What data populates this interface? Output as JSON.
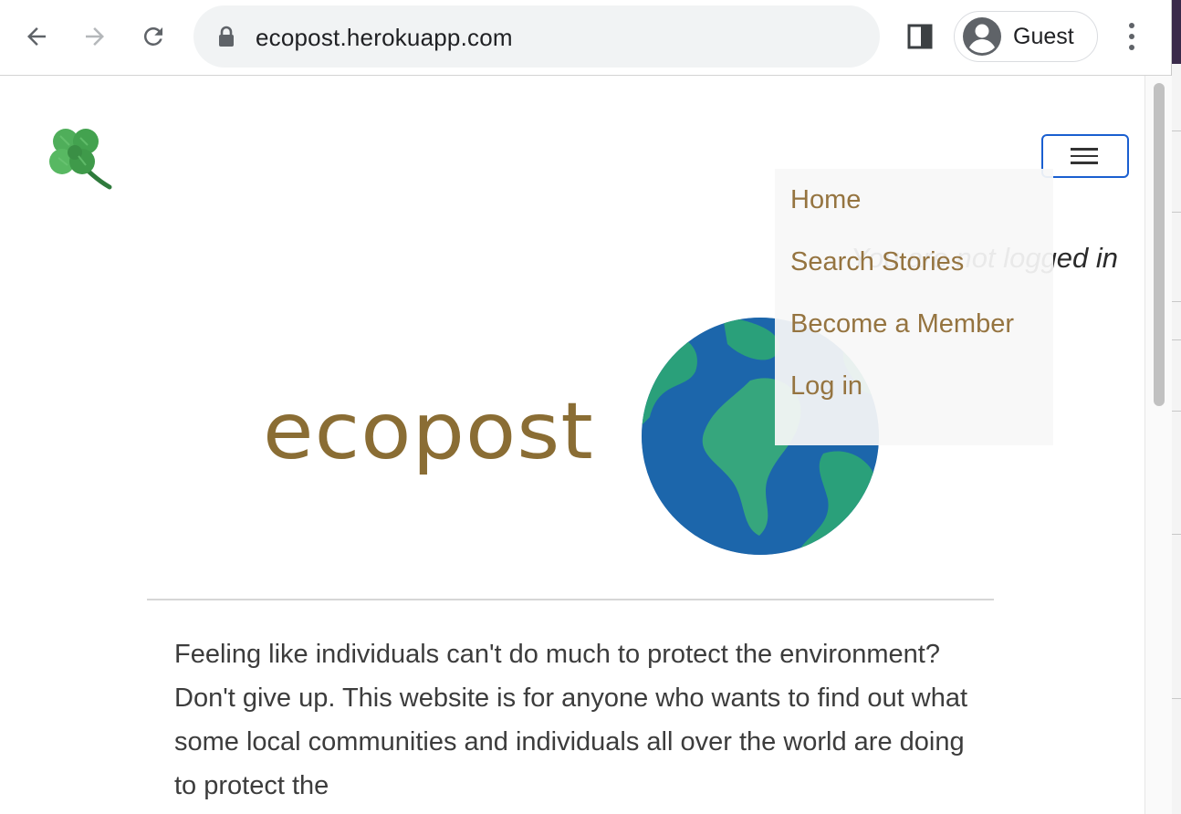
{
  "browser": {
    "url": "ecopost.herokuapp.com",
    "profile_name": "Guest"
  },
  "page": {
    "login_status": "You are not logged in",
    "brand": "ecopost",
    "nav_menu": [
      {
        "label": "Home"
      },
      {
        "label": "Search Stories"
      },
      {
        "label": "Become a Member"
      },
      {
        "label": "Log in"
      }
    ],
    "intro_text": "Feeling like individuals can't do much to protect the environment? Don't give up. This website is for anyone who wants to find out what some local communities and individuals all over the world are doing to protect the",
    "colors": {
      "brand": "#8a6d34",
      "nav_link": "#957440",
      "focus_outline": "#1a5fd0"
    }
  },
  "icons": [
    "back-arrow-icon",
    "forward-arrow-icon",
    "reload-icon",
    "lock-icon",
    "side-panel-icon",
    "profile-avatar-icon",
    "more-options-icon",
    "clover-logo-icon",
    "hamburger-menu-icon",
    "earth-globe-icon"
  ]
}
